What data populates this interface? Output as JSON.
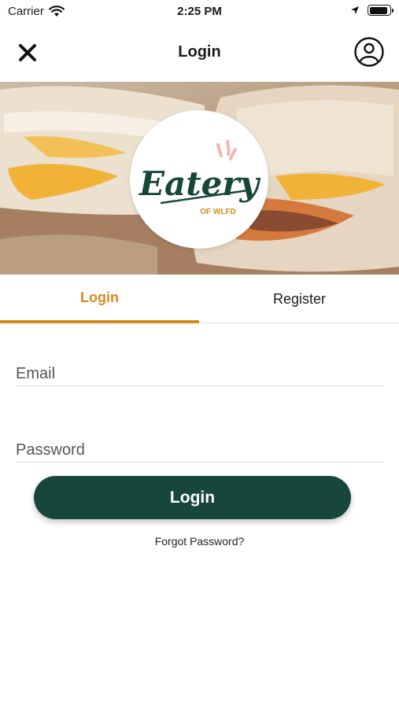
{
  "status_bar": {
    "carrier": "Carrier",
    "time": "2:25 PM",
    "battery_level": 0.9
  },
  "nav": {
    "title": "Login",
    "close_icon": "close-icon",
    "profile_icon": "user-circle-icon"
  },
  "hero": {
    "logo_text": "Eatery",
    "logo_subtext": "OF WLFD",
    "logo_color": "#17473b",
    "accent_color": "#d58a1d"
  },
  "tabs": [
    {
      "label": "Login",
      "active": true
    },
    {
      "label": "Register",
      "active": false
    }
  ],
  "form": {
    "email_placeholder": "Email",
    "email_value": "",
    "password_placeholder": "Password",
    "password_value": "",
    "submit_label": "Login",
    "forgot_label": "Forgot Password?"
  },
  "colors": {
    "primary": "#17473b",
    "accent": "#d58a1d",
    "background": "#ffffff"
  }
}
